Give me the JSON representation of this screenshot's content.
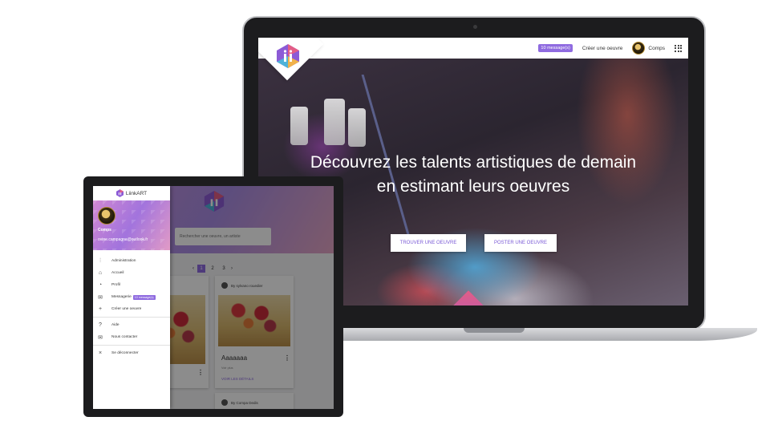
{
  "laptop": {
    "nav": {
      "messages_badge": "10 message(s)",
      "create_link": "Créer une oeuvre",
      "user_name": "Comps"
    },
    "hero": {
      "title_line1": "Découvrez les talents artistiques de demain",
      "title_line2": "en estimant leurs oeuvres",
      "find_button": "TROUVER UNE OEUVRE",
      "post_button": "POSTER UNE OEUVRE"
    }
  },
  "tablet": {
    "drawer": {
      "brand": "LiinkART",
      "user_name": "Comps",
      "user_email": "ovine.campagna@outlook.fr",
      "items": [
        {
          "label": "Administration",
          "icon": "sliders-icon"
        },
        {
          "label": "Accueil",
          "icon": "home-icon"
        },
        {
          "label": "Profil",
          "icon": "profile-icon"
        },
        {
          "label": "Messagerie",
          "icon": "mail-icon",
          "badge": "10 message(s)"
        },
        {
          "label": "Créer une oeuvre",
          "icon": "plus-icon"
        }
      ],
      "items_secondary": [
        {
          "label": "Aide",
          "icon": "help-icon"
        },
        {
          "label": "Nous contacter",
          "icon": "mail-icon"
        }
      ],
      "logout": "Se déconnecter"
    },
    "search_placeholder": "Rechercher une oeuvre, un artiste",
    "pagination": [
      "1",
      "2",
      "3"
    ],
    "cards": [
      {
        "author": "By sylvano rouedier",
        "title": "Aaaaaaa",
        "meta": "Voir plus",
        "link": "VOIR LES DÉTAILS"
      },
      {
        "author": "By Compa Dedis",
        "title": "",
        "meta": "",
        "link": ""
      }
    ]
  },
  "colors": {
    "accent": "#8f6be0"
  }
}
